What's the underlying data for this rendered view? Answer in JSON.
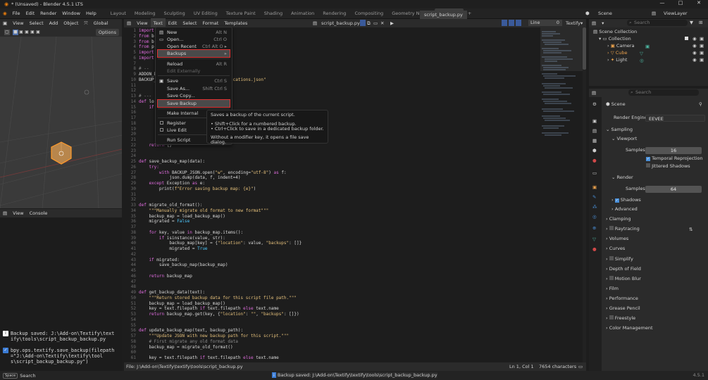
{
  "titlebar": {
    "title": "* (Unsaved) - Blender 4.5.1 LTS",
    "min": "—",
    "max": "□",
    "close": "✕"
  },
  "topbar": {
    "menus": [
      "File",
      "Edit",
      "Render",
      "Window",
      "Help"
    ],
    "workspaces": [
      "Layout",
      "Modeling",
      "Sculpting",
      "UV Editing",
      "Texture Paint",
      "Shading",
      "Animation",
      "Rendering",
      "Compositing",
      "Geometry Nodes",
      "Scripting"
    ],
    "active_workspace": "Scripting",
    "add_tab": "+",
    "scene": "Scene",
    "view_layer": "ViewLayer"
  },
  "viewport": {
    "menus": [
      "View",
      "Select",
      "Add",
      "Object"
    ],
    "orientation": "Global",
    "options": "Options"
  },
  "console": {
    "menus": [
      "View",
      "Console"
    ],
    "messages": [
      {
        "icon": "info-icon",
        "text": "Backup saved: J:\\Add-on\\Textify\\text\nify\\tools\\script_backup_backup.py"
      },
      {
        "icon": "check-icon",
        "text": "bpy.ops.textify.save_backup(filepath\n=\"J:\\Add-on\\Textify\\textify\\tool\ns\\script_backup_backup.py\")"
      }
    ]
  },
  "text_editor": {
    "menus": [
      "View",
      "Text",
      "Edit",
      "Select",
      "Format",
      "Templates"
    ],
    "file_name": "script_backup.py",
    "line_label": "Line",
    "line_value": "0",
    "textify": "Textify",
    "tab_name": "script_backup.py"
  },
  "code": [
    {
      "n": "1",
      "parts": [
        [
          "kw",
          "import"
        ]
      ]
    },
    {
      "n": "2",
      "parts": [
        [
          "kw",
          "from"
        ],
        [
          "fn",
          " b"
        ]
      ]
    },
    {
      "n": "3",
      "parts": [
        [
          "kw",
          "from"
        ],
        [
          "fn",
          " b"
        ]
      ]
    },
    {
      "n": "4",
      "parts": [
        [
          "kw",
          "from"
        ],
        [
          "fn",
          " p"
        ]
      ]
    },
    {
      "n": "5",
      "parts": [
        [
          "kw",
          "import"
        ]
      ]
    },
    {
      "n": "6",
      "parts": [
        [
          "kw",
          "import"
        ]
      ]
    },
    {
      "n": "7",
      "parts": []
    },
    {
      "n": "8",
      "parts": [
        [
          "cm",
          "# --"
        ]
      ]
    },
    {
      "n": "9",
      "parts": [
        [
          "fn",
          "ADDON_D"
        ]
      ]
    },
    {
      "n": "10",
      "parts": [
        [
          "fn",
          "BACKUP_"
        ],
        [
          "st",
          "                              cations.json\""
        ]
      ]
    },
    {
      "n": "11",
      "parts": []
    },
    {
      "n": "12",
      "parts": []
    },
    {
      "n": "13",
      "parts": [
        [
          "cm",
          "# ---"
        ]
      ]
    },
    {
      "n": "14",
      "parts": [
        [
          "kw",
          "def"
        ],
        [
          "fn",
          " lo"
        ]
      ]
    },
    {
      "n": "15",
      "parts": [
        [
          "kw",
          "    if"
        ]
      ]
    },
    {
      "n": "16",
      "parts": []
    },
    {
      "n": "17",
      "parts": []
    },
    {
      "n": "18",
      "parts": []
    },
    {
      "n": "19",
      "parts": []
    },
    {
      "n": "20",
      "parts": []
    },
    {
      "n": "21",
      "parts": []
    },
    {
      "n": "22",
      "parts": [
        [
          "kw",
          "    return"
        ],
        [
          "fn",
          " {}"
        ]
      ]
    },
    {
      "n": "23",
      "parts": []
    },
    {
      "n": "24",
      "parts": []
    },
    {
      "n": "25",
      "parts": [
        [
          "kw",
          "def"
        ],
        [
          "fn",
          " save_backup_map(data):"
        ]
      ]
    },
    {
      "n": "26",
      "parts": [
        [
          "kw",
          "    try:"
        ]
      ]
    },
    {
      "n": "27",
      "parts": [
        [
          "kw",
          "        with"
        ],
        [
          "fn",
          " BACKUP_JSON.open("
        ],
        [
          "st",
          "\"w\""
        ],
        [
          "fn",
          ", encoding="
        ],
        [
          "st",
          "\"utf-8\""
        ],
        [
          "fn",
          ") "
        ],
        [
          "kw",
          "as"
        ],
        [
          "fn",
          " f:"
        ]
      ]
    },
    {
      "n": "28",
      "parts": [
        [
          "fn",
          "            json.dump(data, f, indent=4)"
        ]
      ]
    },
    {
      "n": "29",
      "parts": [
        [
          "kw",
          "    except"
        ],
        [
          "fn",
          " Exception "
        ],
        [
          "kw",
          "as"
        ],
        [
          "fn",
          " e:"
        ]
      ]
    },
    {
      "n": "30",
      "parts": [
        [
          "fn",
          "        print("
        ],
        [
          "st",
          "f\"Error saving backup map: {e}\""
        ],
        [
          "fn",
          ")"
        ]
      ]
    },
    {
      "n": "31",
      "parts": []
    },
    {
      "n": "32",
      "parts": []
    },
    {
      "n": "33",
      "parts": [
        [
          "kw",
          "def"
        ],
        [
          "fn",
          " migrate_old_format():"
        ]
      ]
    },
    {
      "n": "34",
      "parts": [
        [
          "st",
          "    \"\"\"Manually migrate old format to new format\"\"\""
        ]
      ]
    },
    {
      "n": "35",
      "parts": [
        [
          "fn",
          "    backup_map = load_backup_map()"
        ]
      ]
    },
    {
      "n": "36",
      "parts": [
        [
          "fn",
          "    migrated = "
        ],
        [
          "sp",
          "False"
        ]
      ]
    },
    {
      "n": "37",
      "parts": []
    },
    {
      "n": "38",
      "parts": [
        [
          "kw",
          "    for"
        ],
        [
          "fn",
          " key, value "
        ],
        [
          "kw",
          "in"
        ],
        [
          "fn",
          " backup_map.items():"
        ]
      ]
    },
    {
      "n": "39",
      "parts": [
        [
          "kw",
          "        if"
        ],
        [
          "fn",
          " isinstance(value, str):"
        ]
      ]
    },
    {
      "n": "40",
      "parts": [
        [
          "fn",
          "            backup_map[key] = {"
        ],
        [
          "st",
          "\"location\""
        ],
        [
          "fn",
          ": value, "
        ],
        [
          "st",
          "\"backups\""
        ],
        [
          "fn",
          ": []}"
        ]
      ]
    },
    {
      "n": "41",
      "parts": [
        [
          "fn",
          "            migrated = "
        ],
        [
          "sp",
          "True"
        ]
      ]
    },
    {
      "n": "42",
      "parts": []
    },
    {
      "n": "43",
      "parts": [
        [
          "kw",
          "    if"
        ],
        [
          "fn",
          " migrated:"
        ]
      ]
    },
    {
      "n": "44",
      "parts": [
        [
          "fn",
          "        save_backup_map(backup_map)"
        ]
      ]
    },
    {
      "n": "45",
      "parts": []
    },
    {
      "n": "46",
      "parts": [
        [
          "kw",
          "    return"
        ],
        [
          "fn",
          " backup_map"
        ]
      ]
    },
    {
      "n": "47",
      "parts": []
    },
    {
      "n": "48",
      "parts": []
    },
    {
      "n": "49",
      "parts": [
        [
          "kw",
          "def"
        ],
        [
          "fn",
          " get_backup_data(text):"
        ]
      ]
    },
    {
      "n": "50",
      "parts": [
        [
          "st",
          "    \"\"\"Return stored backup data for this script file path.\"\"\""
        ]
      ]
    },
    {
      "n": "51",
      "parts": [
        [
          "fn",
          "    backup_map = load_backup_map()"
        ]
      ]
    },
    {
      "n": "52",
      "parts": [
        [
          "fn",
          "    key = text.filepath "
        ],
        [
          "kw",
          "if"
        ],
        [
          "fn",
          " text.filepath "
        ],
        [
          "kw",
          "else"
        ],
        [
          "fn",
          " text.name"
        ]
      ]
    },
    {
      "n": "53",
      "parts": [
        [
          "kw",
          "    return"
        ],
        [
          "fn",
          " backup_map.get(key, {"
        ],
        [
          "st",
          "\"location\""
        ],
        [
          "fn",
          ": "
        ],
        [
          "st",
          "\"\""
        ],
        [
          "fn",
          ", "
        ],
        [
          "st",
          "\"backups\""
        ],
        [
          "fn",
          ": []})"
        ]
      ]
    },
    {
      "n": "54",
      "parts": []
    },
    {
      "n": "55",
      "parts": []
    },
    {
      "n": "56",
      "parts": [
        [
          "kw",
          "def"
        ],
        [
          "fn",
          " update_backup_map(text, backup_path):"
        ]
      ]
    },
    {
      "n": "57",
      "parts": [
        [
          "st",
          "    \"\"\"Update JSON with new backup path for this script.\"\"\""
        ]
      ]
    },
    {
      "n": "58",
      "parts": [
        [
          "cm",
          "    # First migrate any old format data"
        ]
      ]
    },
    {
      "n": "59",
      "parts": [
        [
          "fn",
          "    backup_map = migrate_old_format()"
        ]
      ]
    },
    {
      "n": "60",
      "parts": []
    },
    {
      "n": "61",
      "parts": [
        [
          "fn",
          "    key = text.filepath "
        ],
        [
          "kw",
          "if"
        ],
        [
          "fn",
          " text.filepath "
        ],
        [
          "kw",
          "else"
        ],
        [
          "fn",
          " text.name"
        ]
      ]
    }
  ],
  "text_menu": {
    "items": [
      {
        "label": "New",
        "shortcut": "Alt N",
        "icon": "new-file-icon"
      },
      {
        "label": "Open...",
        "shortcut": "Ctrl O",
        "icon": "folder-icon"
      },
      {
        "label": "Open Recent",
        "shortcut": "Ctrl Alt O ▸"
      },
      {
        "label": "Backups",
        "shortcut": "▸"
      },
      {
        "label": "Reload",
        "shortcut": "Alt R"
      },
      {
        "label": "Edit Externally",
        "shortcut": ""
      },
      {
        "label": "Save",
        "shortcut": "Ctrl S",
        "icon": "save-icon"
      },
      {
        "label": "Save As...",
        "shortcut": "Shift Ctrl S"
      },
      {
        "label": "Save Copy...",
        "shortcut": ""
      },
      {
        "label": "Save Backup",
        "shortcut": ""
      },
      {
        "label": "Make Internal",
        "shortcut": ""
      },
      {
        "label": "Register",
        "shortcut": ""
      },
      {
        "label": "Live Edit",
        "shortcut": ""
      },
      {
        "label": "Run Script",
        "shortcut": ""
      }
    ]
  },
  "tooltip": {
    "line1": "Saves a backup of the current script.",
    "line2": "• Shift+Click for a numbered backup.",
    "line3": "• Ctrl+Click to save in a dedicated backup folder.",
    "line4": "Without a modifier key, it opens a file save dialog."
  },
  "footer": {
    "file": "File: J:\\Add-on\\Textify\\textify\\tools\\script_backup.py",
    "position": "Ln 1, Col 1",
    "chars": "7654 characters"
  },
  "outliner": {
    "search_placeholder": "Search",
    "items": [
      "Scene Collection",
      "Collection",
      "Camera",
      "Cube",
      "Light"
    ]
  },
  "properties": {
    "search_placeholder": "Search",
    "scene_label": "Scene",
    "render_engine_label": "Render Engine",
    "render_engine": "EEVEE",
    "sampling": "Sampling",
    "viewport": "Viewport",
    "samples_label": "Samples",
    "viewport_samples": "16",
    "temporal_reprojection": "Temporal Reprojection",
    "jittered_shadows": "Jittered Shadows",
    "render": "Render",
    "render_samples": "64",
    "shadows": "Shadows",
    "advanced": "Advanced",
    "panels": [
      "Clamping",
      "Raytracing",
      "Volumes",
      "Curves",
      "Simplify",
      "Depth of Field",
      "Motion Blur",
      "Film",
      "Performance",
      "Grease Pencil",
      "Freestyle",
      "Color Management"
    ]
  },
  "statusbar": {
    "search": "Search",
    "message": "Backup saved: J:\\Add-on\\Textify\\textify\\tools\\script_backup_backup.py",
    "version": "4.5.1"
  },
  "colors": {
    "accent": "#e03030",
    "brand": "#e87d0d",
    "keyword": "#e06cdf",
    "string": "#e5c07b"
  }
}
